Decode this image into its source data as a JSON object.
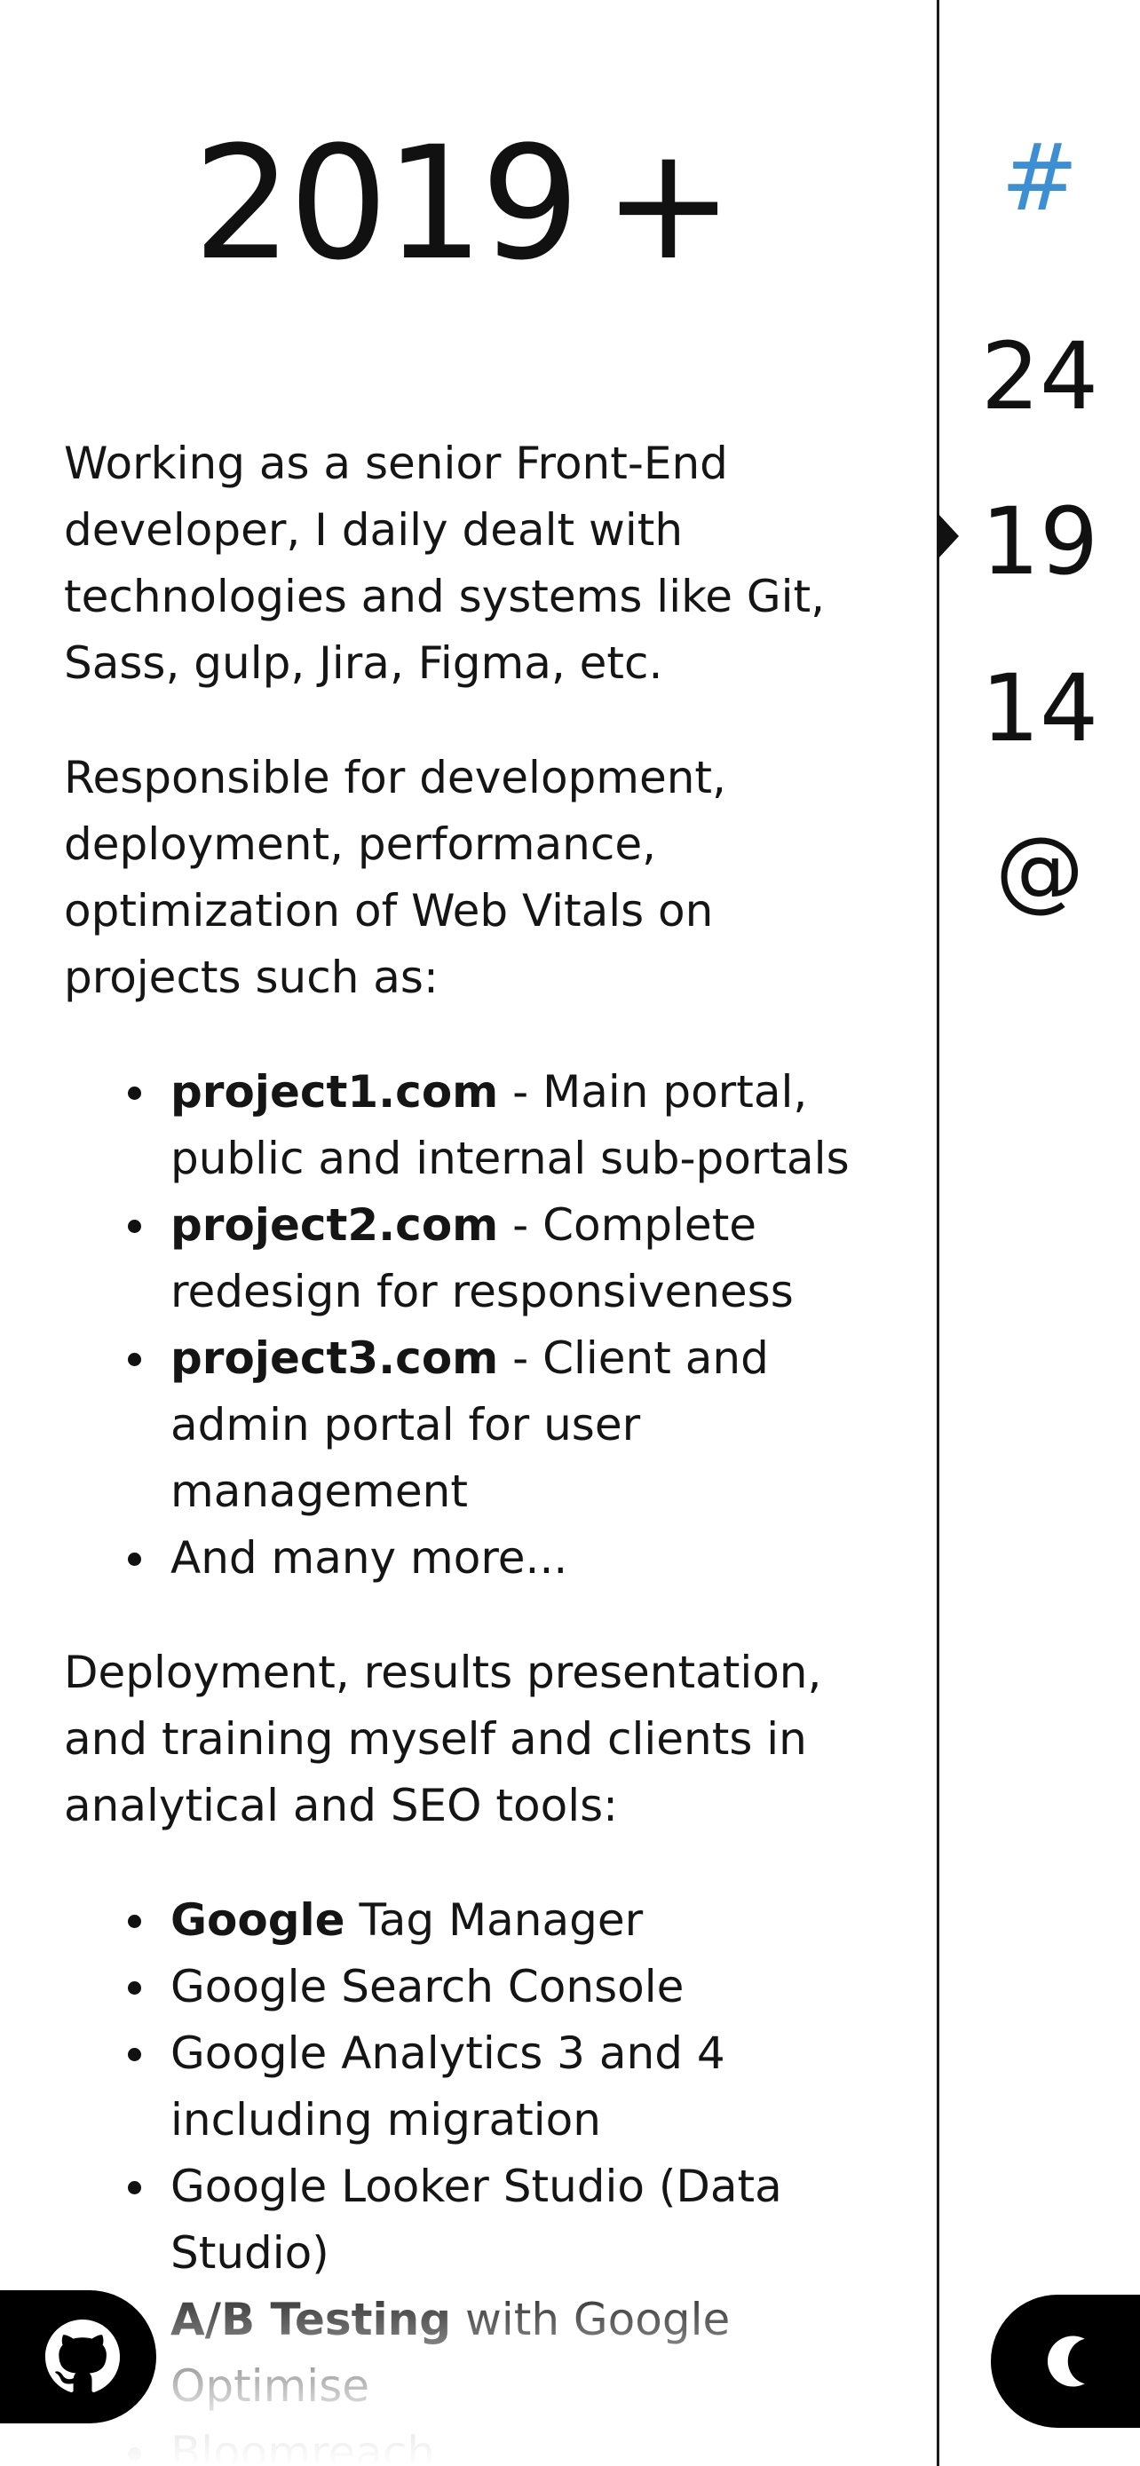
{
  "page": {
    "year": "2019",
    "year_plus": "+"
  },
  "content": {
    "intro": "Working as a senior Front-End developer, I daily dealt with technologies and systems like Git, Sass, gulp, Jira, Figma, etc.",
    "responsibility": "Responsible for development, deployment, performance, optimization of Web Vitals on projects such as:",
    "projects": [
      {
        "name": "project1.com",
        "desc": " - Main portal, public and internal sub-portals"
      },
      {
        "name": "project2.com",
        "desc": " - Complete redesign for responsiveness"
      },
      {
        "name": "project3.com",
        "desc": " - Client and admin portal for user management"
      },
      {
        "name": "",
        "desc": "And many more..."
      }
    ],
    "tools_intro": "Deployment, results presentation, and training myself and clients in analytical and SEO tools:",
    "tools": [
      {
        "bold": "Google",
        "rest": " Tag Manager"
      },
      {
        "bold": "",
        "rest": "Google Search Console"
      },
      {
        "bold": "",
        "rest": "Google Analytics 3 and 4 including migration"
      },
      {
        "bold": "",
        "rest": "Google Looker Studio (Data Studio)"
      },
      {
        "bold": "A/B Testing",
        "rest": " with Google Optimise"
      },
      {
        "bold": "",
        "rest": "Bloomreach"
      }
    ]
  },
  "nav": {
    "items": [
      {
        "label": "#",
        "active": false
      },
      {
        "label": "24",
        "active": false
      },
      {
        "label": "19",
        "active": true
      },
      {
        "label": "14",
        "active": false
      },
      {
        "label": "@",
        "active": false
      }
    ],
    "accent_color": "#3d8fd4"
  },
  "buttons": {
    "github_icon": "github-icon",
    "theme_icon": "moon-icon"
  }
}
